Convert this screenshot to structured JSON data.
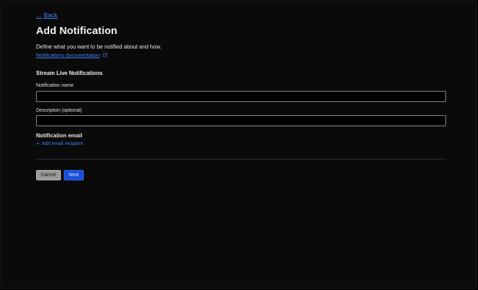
{
  "nav": {
    "back_arrow": "←",
    "back_label": "Back"
  },
  "header": {
    "title": "Add Notification",
    "subtitle": "Define what you want to be notified about and how.",
    "doc_link_label": "Notifications documentation",
    "doc_link_icon": "external-link-icon"
  },
  "form": {
    "section_title": "Stream Live Notifications",
    "name_label": "Notification name",
    "name_value": "",
    "name_placeholder": "",
    "description_label": "Description (optional)",
    "description_value": "",
    "description_placeholder": "",
    "email_heading": "Notification email",
    "add_recipient_icon": "+",
    "add_recipient_label": "Add email recipient"
  },
  "actions": {
    "cancel_label": "Cancel",
    "next_label": "Next"
  },
  "colors": {
    "background": "#0a0a0a",
    "accent": "#3b82f6",
    "primary_button": "#1d4ed8",
    "secondary_button": "#9a9a9a"
  }
}
